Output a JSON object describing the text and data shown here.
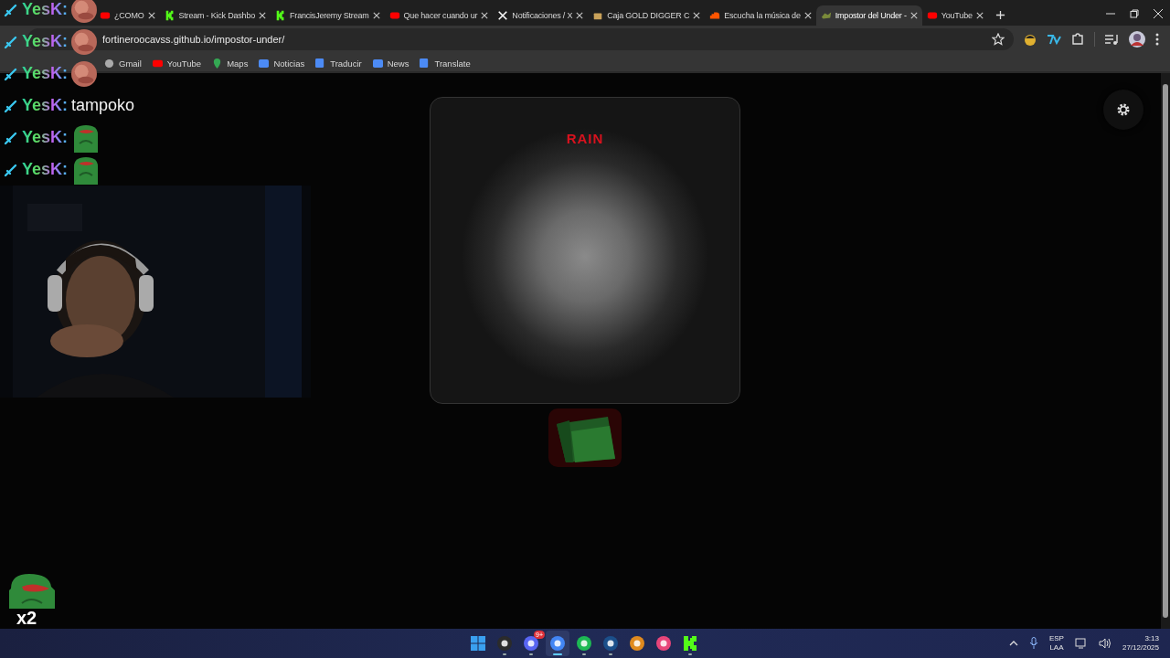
{
  "browser": {
    "tabs": [
      {
        "title": "¿COMO",
        "kind": "youtube",
        "selected": false
      },
      {
        "title": "Stream - Kick Dashbo",
        "kind": "kick",
        "selected": false
      },
      {
        "title": "FrancisJeremy Stream",
        "kind": "kick",
        "selected": false
      },
      {
        "title": "Que hacer cuando ur",
        "kind": "youtube",
        "selected": false
      },
      {
        "title": "Notificaciones / X",
        "kind": "x",
        "selected": false
      },
      {
        "title": "Caja GOLD DIGGER C",
        "kind": "box",
        "selected": false
      },
      {
        "title": "Escucha la música de",
        "kind": "soundcloud",
        "selected": false
      },
      {
        "title": "Impostor del Under -",
        "kind": "game",
        "selected": true
      },
      {
        "title": "YouTube",
        "kind": "youtube",
        "selected": false
      }
    ],
    "address": "fortineroocavss.github.io/impostor-under/",
    "bookmarks": [
      {
        "label": "Gmail",
        "kind": "globe"
      },
      {
        "label": "YouTube",
        "kind": "youtube"
      },
      {
        "label": "Maps",
        "kind": "maps"
      },
      {
        "label": "Noticias",
        "kind": "news"
      },
      {
        "label": "Traducir",
        "kind": "translate"
      },
      {
        "label": "News",
        "kind": "news"
      },
      {
        "label": "Translate",
        "kind": "translate"
      }
    ]
  },
  "game": {
    "title": "RAIN"
  },
  "stream_overlay": {
    "chat": [
      {
        "user": "YesK:",
        "kind": "picture"
      },
      {
        "user": "YesK:",
        "kind": "picture"
      },
      {
        "user": "YesK:",
        "kind": "picture"
      },
      {
        "user": "YesK:",
        "kind": "text",
        "text": "tampoko"
      },
      {
        "user": "YesK:",
        "kind": "emote"
      },
      {
        "user": "YesK:",
        "kind": "emote"
      }
    ],
    "combo": "x2"
  },
  "taskbar": {
    "apps": [
      {
        "kind": "start",
        "running": false,
        "selected": false
      },
      {
        "kind": "obs",
        "running": true,
        "selected": false
      },
      {
        "kind": "discord",
        "running": true,
        "selected": false,
        "badge": "9+"
      },
      {
        "kind": "chrome",
        "running": true,
        "selected": true
      },
      {
        "kind": "spotify",
        "running": true,
        "selected": false
      },
      {
        "kind": "steam",
        "running": true,
        "selected": false
      },
      {
        "kind": "fl",
        "running": false,
        "selected": false
      },
      {
        "kind": "osu",
        "running": false,
        "selected": false
      },
      {
        "kind": "kick",
        "running": true,
        "selected": false
      }
    ],
    "language": "ESP",
    "layout": "LAA",
    "time": "3:13",
    "date": "27/12/2025"
  }
}
